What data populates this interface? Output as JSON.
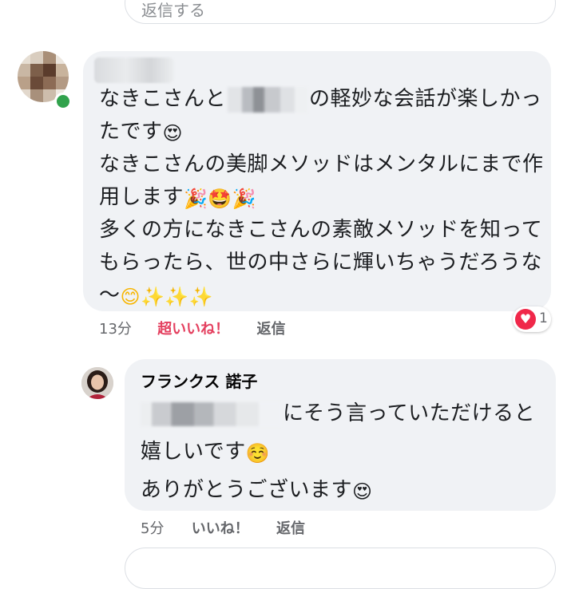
{
  "previous_reply_input": {
    "placeholder": "返信する"
  },
  "comment": {
    "lines": [
      {
        "before": "なきこさんと",
        "after": "の軽妙な会話が楽しかっ"
      },
      {
        "text": "たです",
        "emoji": "😍"
      },
      {
        "text": "なきこさんの美脚メソッドはメンタルにまで作"
      },
      {
        "text": "用します",
        "emoji": "🎉🤩🎉"
      },
      {
        "text": "多くの方になきこさんの素敵メソッドを知って"
      },
      {
        "text": "もらったら、世の中さらに輝いちゃうだろうな"
      },
      {
        "text": "〜",
        "emoji": "😊✨✨✨"
      }
    ],
    "time": "13分",
    "reaction_label": "超いいね！",
    "reply_label": "返信",
    "reaction_icon": "heart-icon",
    "reaction_count": "1"
  },
  "reply": {
    "author": "フランクス 諾子",
    "lines": [
      {
        "after": "にそう言っていただけると"
      },
      {
        "text": "嬉しいです",
        "emoji": "☺️"
      },
      {
        "text": "ありがとうございます",
        "emoji": "😍"
      }
    ],
    "time": "5分",
    "like_label": "いいね！",
    "reply_label": "返信"
  },
  "colors": {
    "bubble": "#f0f2f5",
    "meta_text": "#65676b",
    "super_like": "#e4405f",
    "heart": "#f0284a",
    "online": "#31a24c"
  }
}
